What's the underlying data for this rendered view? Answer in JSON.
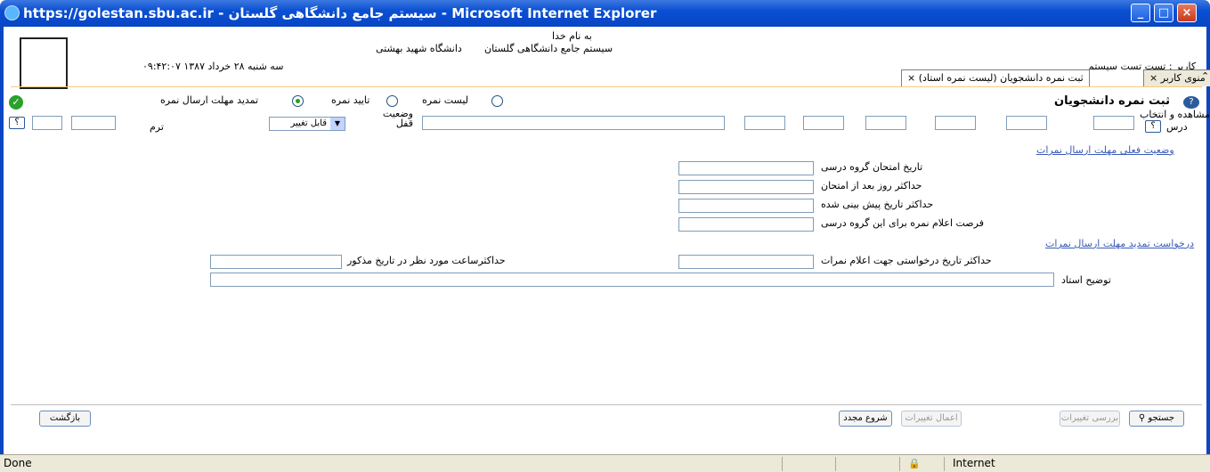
{
  "window": {
    "title": "https://golestan.sbu.ac.ir - سیستم جامع دانشگاهی گلستان - Microsoft Internet Explorer",
    "min": "_",
    "max": "□",
    "close": "×"
  },
  "header": {
    "bismillah": "به نام خدا",
    "system": "سیستم جامع دانشگاهی گلستان",
    "university": "دانشگاه شهید بهشتی",
    "datetime": "۰۹:۴۲:۰۷ سه شنبه ۲۸ خرداد ۱۳۸۷",
    "user": "کاربر : تست تست سیستم",
    "logo_text": "دانشگاه شهید بهشتی"
  },
  "tabs": {
    "menu": "منوی کاربر",
    "current": "ثبت نمره دانشجویان (لیست نمره استاد)",
    "close_glyph": "×"
  },
  "form": {
    "title": "ثبت نمره دانشجویان",
    "radio_list": "لیست نمره",
    "radio_confirm": "تایید نمره",
    "radio_extend": "تمدید مهلت ارسال نمره",
    "view_select": "مشاهده و انتخاب",
    "course": "درس",
    "lock_status": "وضعیت قفل",
    "lock_value": "قابل تغییر",
    "term": "ترم",
    "help": "؟"
  },
  "status_section": {
    "heading": "وضعیت فعلی مهلت ارسال نمرات",
    "exam_date": "تاریخ امتحان گروه درسی",
    "max_days": "حداکثر روز بعد از امتحان",
    "max_date": "حداکثر تاریخ پیش بینی شده",
    "chance": "فرصت اعلام نمره برای این گروه درسی"
  },
  "request_section": {
    "heading": "درخواست تمدید مهلت ارسال نمرات",
    "max_req_date": "حداکثر تاریخ درخواستی جهت اعلام نمرات",
    "max_hour": "حداکثرساعت مورد نظر در تاریخ مذکور",
    "teacher_note": "توضیح استاد"
  },
  "buttons": {
    "search": "جستجو",
    "review": "بررسی تغییرات",
    "apply": "اعمال تغییرات",
    "restart": "شروع مجدد",
    "back": "بازگشت"
  },
  "status": {
    "done": "Done",
    "zone": "Internet"
  }
}
